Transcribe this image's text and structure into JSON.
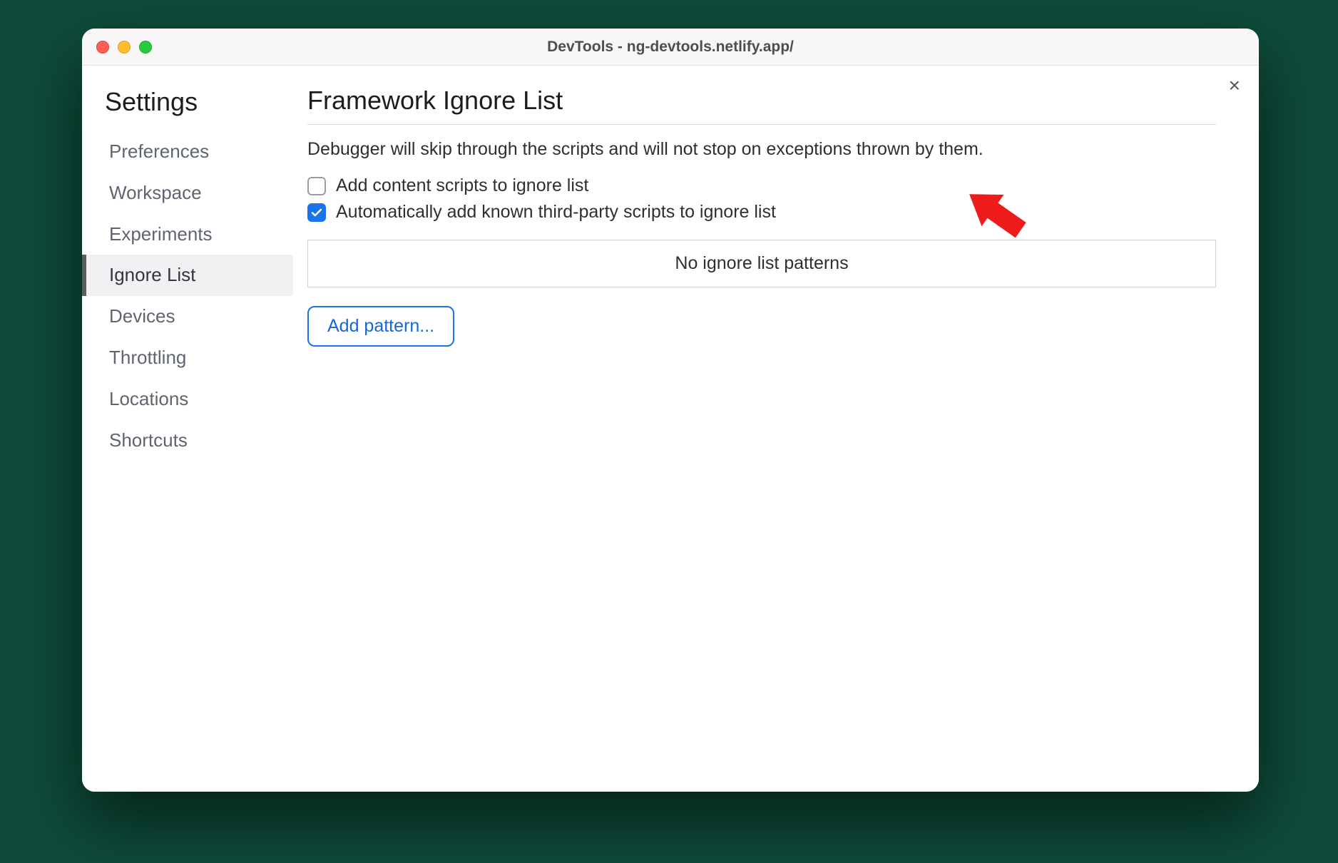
{
  "window": {
    "title": "DevTools - ng-devtools.netlify.app/"
  },
  "close_icon": "×",
  "sidebar": {
    "title": "Settings",
    "items": [
      {
        "label": "Preferences",
        "active": false
      },
      {
        "label": "Workspace",
        "active": false
      },
      {
        "label": "Experiments",
        "active": false
      },
      {
        "label": "Ignore List",
        "active": true
      },
      {
        "label": "Devices",
        "active": false
      },
      {
        "label": "Throttling",
        "active": false
      },
      {
        "label": "Locations",
        "active": false
      },
      {
        "label": "Shortcuts",
        "active": false
      }
    ]
  },
  "main": {
    "title": "Framework Ignore List",
    "subtitle": "Debugger will skip through the scripts and will not stop on exceptions thrown by them.",
    "checkboxes": [
      {
        "label": "Add content scripts to ignore list",
        "checked": false
      },
      {
        "label": "Automatically add known third-party scripts to ignore list",
        "checked": true
      }
    ],
    "empty_patterns_text": "No ignore list patterns",
    "add_pattern_label": "Add pattern..."
  },
  "colors": {
    "accent": "#1a73e8",
    "annotation": "#ee1b1b"
  }
}
